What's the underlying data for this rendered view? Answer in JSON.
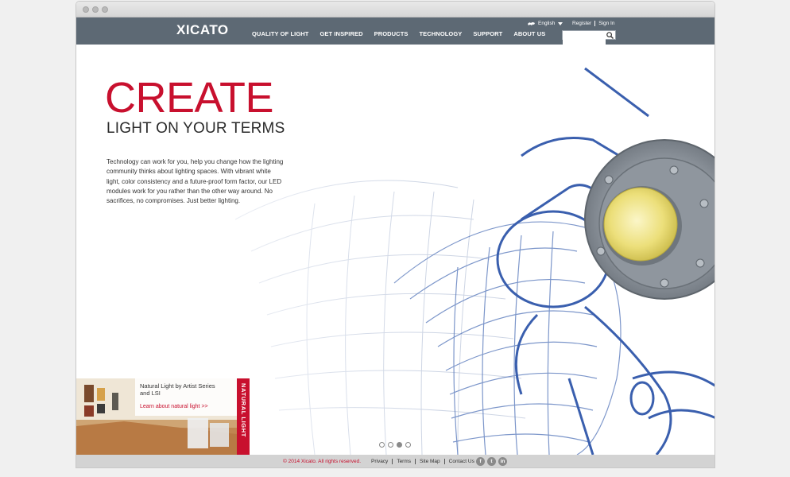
{
  "header": {
    "logo": "XICATO",
    "menu": [
      "QUALITY OF LIGHT",
      "GET INSPIRED",
      "PRODUCTS",
      "TECHNOLOGY",
      "SUPPORT",
      "ABOUT US"
    ],
    "language": "English",
    "register": "Register",
    "signin": "Sign In",
    "search_placeholder": ""
  },
  "hero": {
    "title": "CREATE",
    "subtitle": "LIGHT ON YOUR TERMS",
    "body": "Technology can work for you, help you change how the lighting community thinks about lighting spaces. With vibrant white light, color consistency and a future-proof form factor, our LED modules work for you rather than the other way around. No sacrifices, no compromises. Just better lighting."
  },
  "promo": {
    "title": "Natural Light by Artist Series and LSI",
    "link": "Learn about natural light >>",
    "strip": "NATURAL LIGHT"
  },
  "carousel": {
    "active_index": 2,
    "count": 4
  },
  "footer": {
    "copyright": "© 2014 Xicato. All rights reserved.",
    "links": [
      "Privacy",
      "Terms",
      "Site Map",
      "Contact Us"
    ],
    "social_icons": [
      "facebook-icon",
      "twitter-icon",
      "linkedin-icon"
    ]
  },
  "colors": {
    "brand_red": "#c8102e",
    "nav_bg": "#5d6974",
    "footer_bg": "#d3d3d3"
  }
}
